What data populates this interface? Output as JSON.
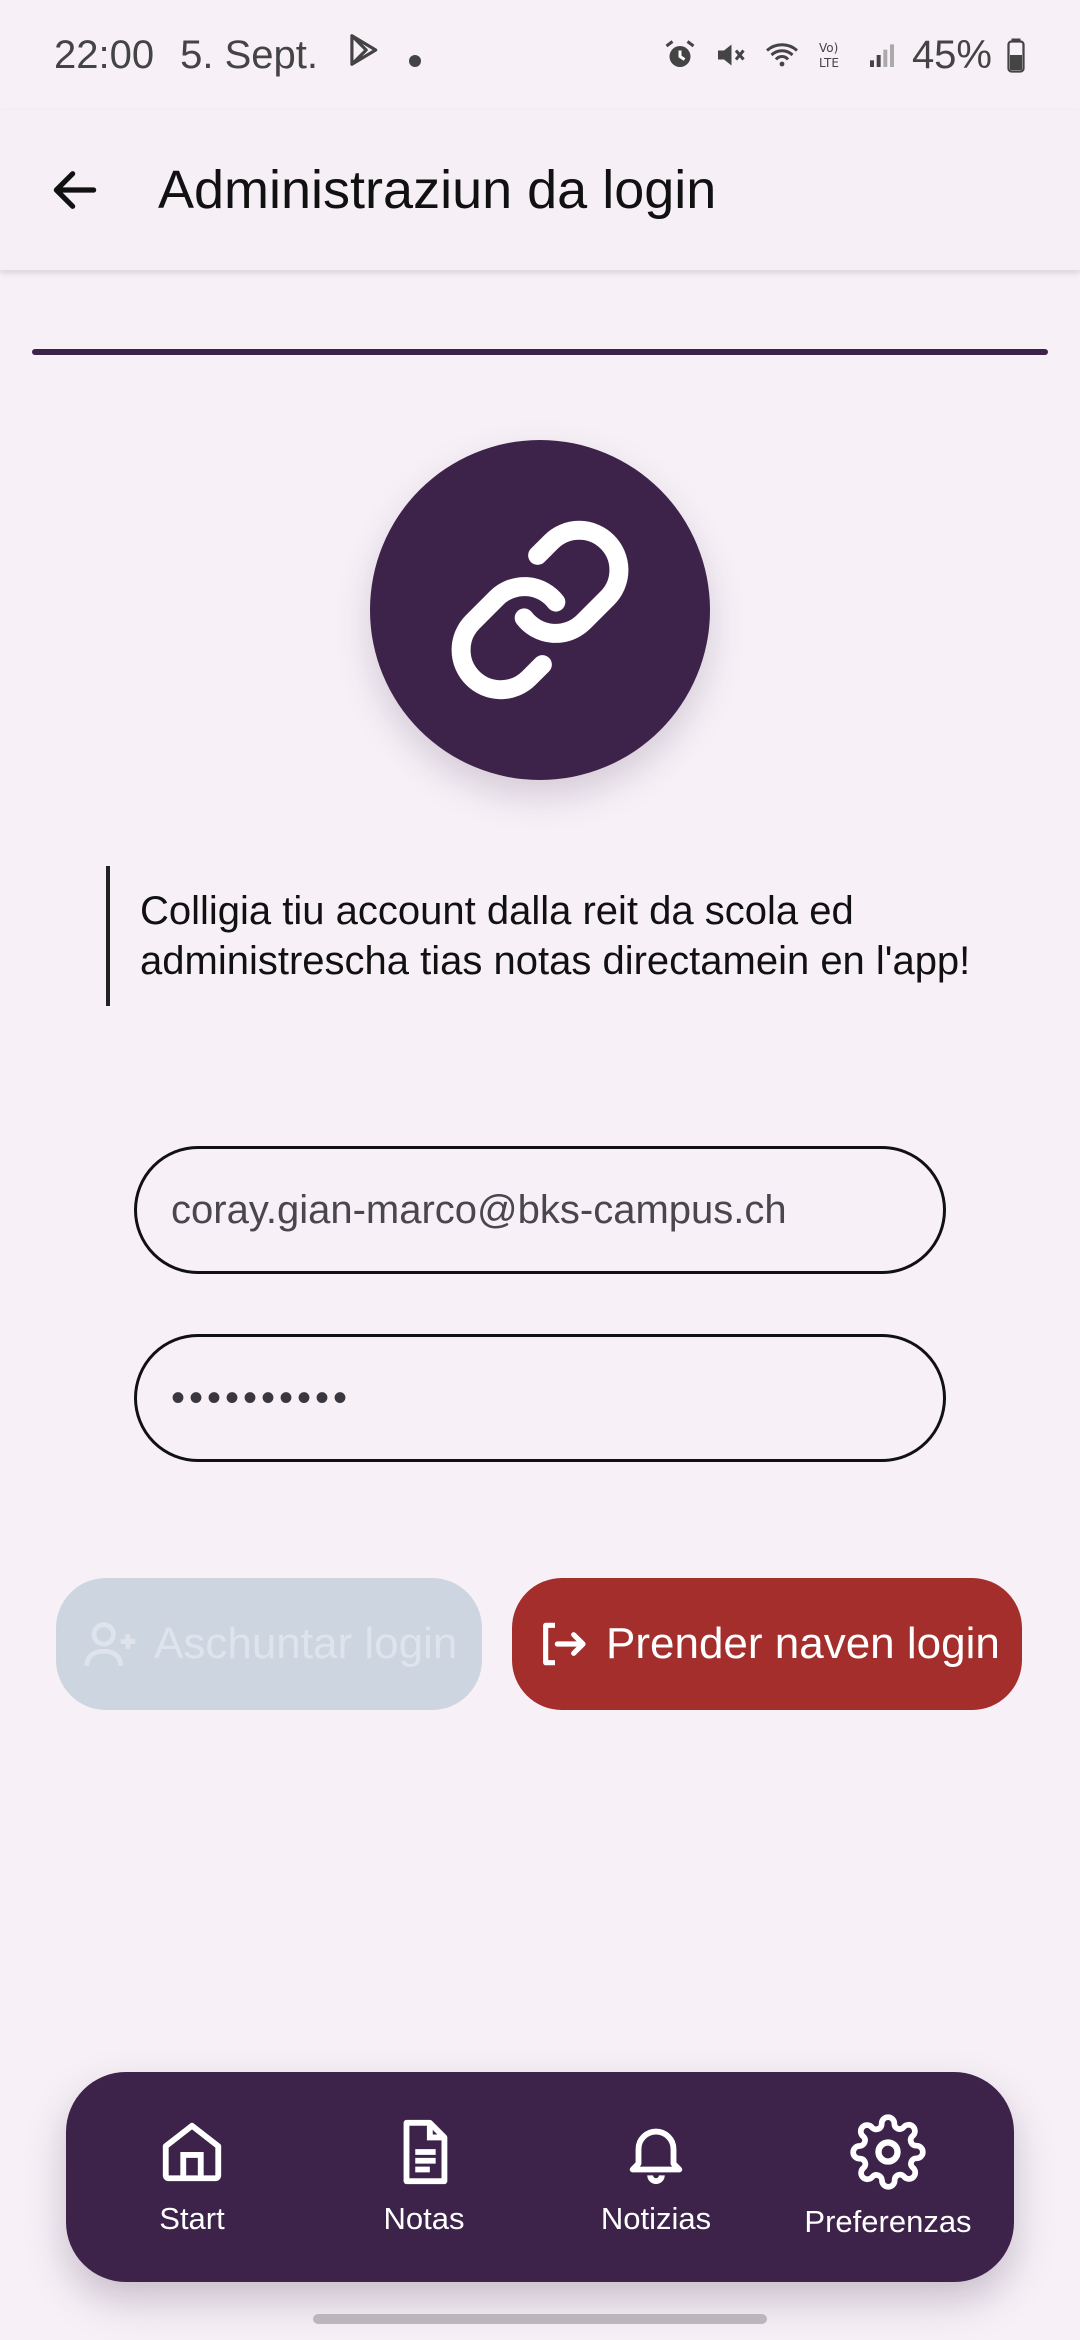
{
  "status_bar": {
    "time": "22:00",
    "date": "5. Sept.",
    "battery": "45%",
    "icons": [
      "play-store-icon",
      "alarm-icon",
      "mute-icon",
      "wifi-icon",
      "volte-icon",
      "signal-icon",
      "battery-icon"
    ]
  },
  "app_bar": {
    "title": "Administraziun da login",
    "back_icon": "arrow-left-icon"
  },
  "header_icon": "link-icon",
  "info_text": "Colligia tiu account dalla reit da scola ed administrescha tias notas directamein en l'app!",
  "form": {
    "email_value": "coray.gian-marco@bks-campus.ch",
    "password_value": "••••••••••"
  },
  "buttons": {
    "add_label": "Aschuntar login",
    "add_icon": "add-user-icon",
    "remove_label": "Prender naven login",
    "remove_icon": "logout-icon"
  },
  "bottom_nav": {
    "items": [
      {
        "label": "Start",
        "icon": "home-icon"
      },
      {
        "label": "Notas",
        "icon": "document-icon"
      },
      {
        "label": "Notizias",
        "icon": "bell-icon"
      },
      {
        "label": "Preferenzas",
        "icon": "gear-icon"
      }
    ]
  },
  "colors": {
    "primary": "#3d2249",
    "background": "#f7f1f7",
    "danger": "#a32e2c",
    "disabled": "#cdd5e1"
  }
}
